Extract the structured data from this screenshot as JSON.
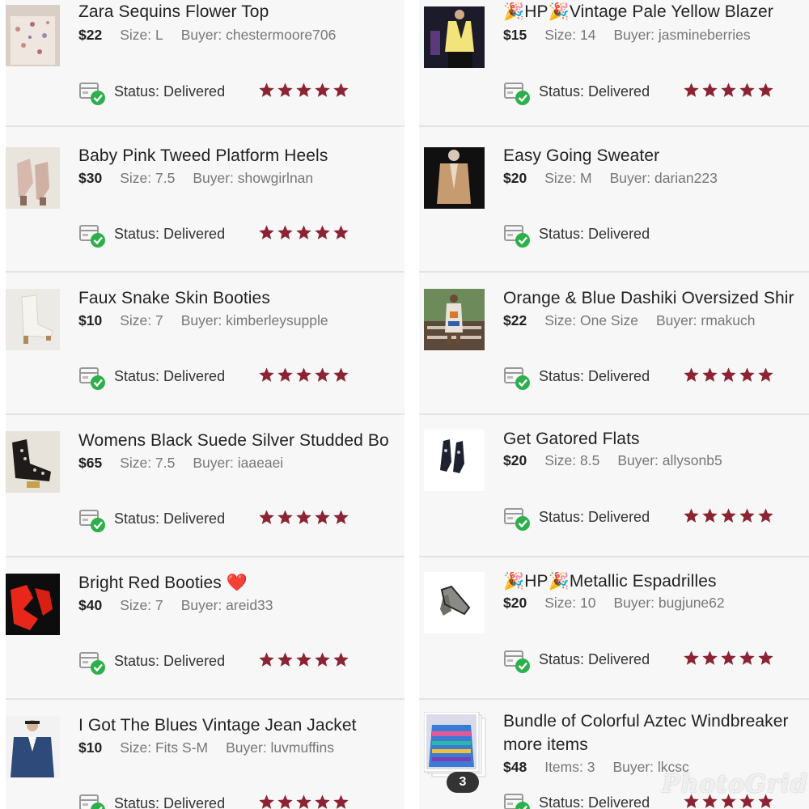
{
  "status_label": "Status:",
  "left_items": [
    {
      "title": "Zara Sequins Flower Top",
      "price": "$22",
      "size": "Size: L",
      "buyer": "Buyer: chestermoore706",
      "status": "Delivered",
      "rating": 5
    },
    {
      "title": "Baby Pink Tweed Platform Heels",
      "price": "$30",
      "size": "Size: 7.5",
      "buyer": "Buyer: showgirlnan",
      "status": "Delivered",
      "rating": 5
    },
    {
      "title": "Faux Snake Skin Booties",
      "price": "$10",
      "size": "Size: 7",
      "buyer": "Buyer: kimberleysupple",
      "status": "Delivered",
      "rating": 5
    },
    {
      "title": "Womens Black Suede Silver Studded Bo",
      "price": "$65",
      "size": "Size: 7.5",
      "buyer": "Buyer: iaaeaei",
      "status": "Delivered",
      "rating": 5
    },
    {
      "title": "Bright Red Booties ❤️",
      "price": "$40",
      "size": "Size: 7",
      "buyer": "Buyer: areid33",
      "status": "Delivered",
      "rating": 5
    },
    {
      "title": "I Got The Blues Vintage Jean Jacket",
      "price": "$10",
      "size": "Size: Fits S-M",
      "buyer": "Buyer: luvmuffins",
      "status": "Delivered",
      "rating": 5
    }
  ],
  "right_items": [
    {
      "title": "🎉HP🎉Vintage Pale Yellow Blazer",
      "price": "$15",
      "size": "Size: 14",
      "buyer": "Buyer: jasmineberries",
      "status": "Delivered",
      "rating": 5
    },
    {
      "title": "Easy Going Sweater",
      "price": "$20",
      "size": "Size: M",
      "buyer": "Buyer: darian223",
      "status": "Delivered",
      "rating": 0
    },
    {
      "title": "Orange & Blue Dashiki Oversized Shir",
      "price": "$22",
      "size": "Size: One Size",
      "buyer": "Buyer: rmakuch",
      "status": "Delivered",
      "rating": 5
    },
    {
      "title": "Get Gatored Flats",
      "price": "$20",
      "size": "Size: 8.5",
      "buyer": "Buyer: allysonb5",
      "status": "Delivered",
      "rating": 5
    },
    {
      "title": "🎉HP🎉Metallic Espadrilles",
      "price": "$20",
      "size": "Size: 10",
      "buyer": "Buyer: bugjune62",
      "status": "Delivered",
      "rating": 5
    },
    {
      "title": "Bundle of Colorful Aztec Windbreaker",
      "title_line2": "more items",
      "price": "$48",
      "size": "Items: 3",
      "buyer": "Buyer: lkcsc",
      "status": "Delivered",
      "rating": 5,
      "bundle_count": "3"
    }
  ],
  "watermark": "PhotoGrid",
  "colors": {
    "star": "#8b2332",
    "check": "#2db04b",
    "divider": "#e3e3e3",
    "panel": "#f7f7f7"
  }
}
